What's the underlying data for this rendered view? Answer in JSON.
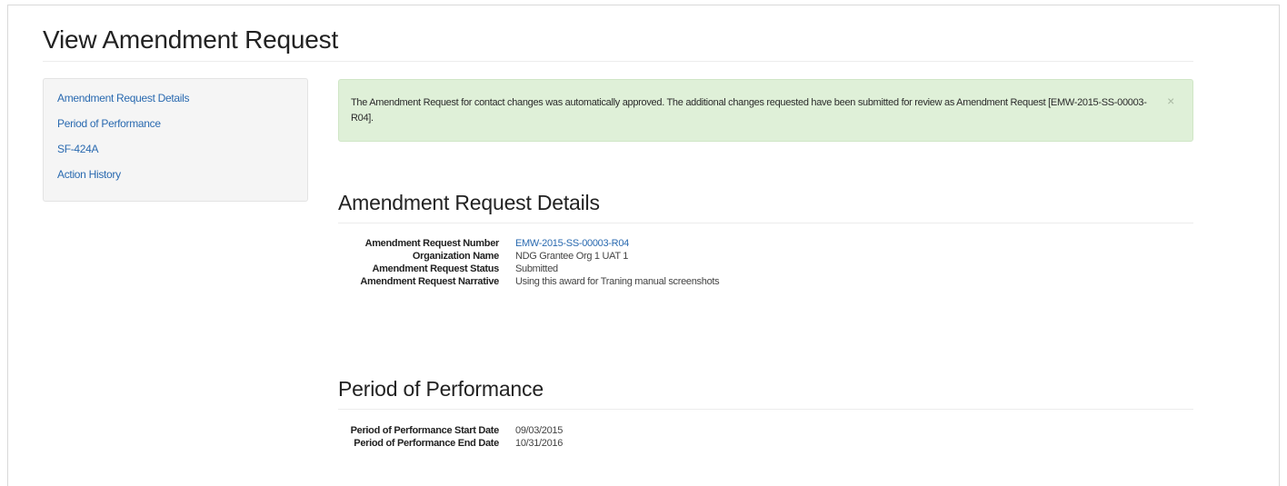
{
  "page": {
    "title": "View Amendment Request"
  },
  "sidebar": {
    "items": [
      {
        "label": "Amendment Request Details"
      },
      {
        "label": "Period of Performance"
      },
      {
        "label": "SF-424A"
      },
      {
        "label": "Action History"
      }
    ]
  },
  "alert": {
    "message": "The Amendment Request for contact changes was automatically approved. The additional changes requested have been submitted for review as Amendment Request [EMW-2015-SS-00003-R04].",
    "close_glyph": "×",
    "background_color": "#dff0d8"
  },
  "amendment_details": {
    "heading": "Amendment Request Details",
    "rows": [
      {
        "term": "Amendment Request Number",
        "value": "EMW-2015-SS-00003-R04"
      },
      {
        "term": "Organization Name",
        "value": "NDG Grantee Org 1 UAT 1"
      },
      {
        "term": "Amendment Request Status",
        "value": "Submitted"
      },
      {
        "term": "Amendment Request Narrative",
        "value": "Using this award for Traning manual screenshots"
      }
    ]
  },
  "period_of_performance": {
    "heading": "Period of Performance",
    "rows": [
      {
        "term": "Period of Performance Start Date",
        "value": "09/03/2015"
      },
      {
        "term": "Period of Performance End Date",
        "value": "10/31/2016"
      }
    ]
  },
  "colors": {
    "link": "#2a6ab0",
    "sidebar_bg": "#f5f5f5"
  }
}
